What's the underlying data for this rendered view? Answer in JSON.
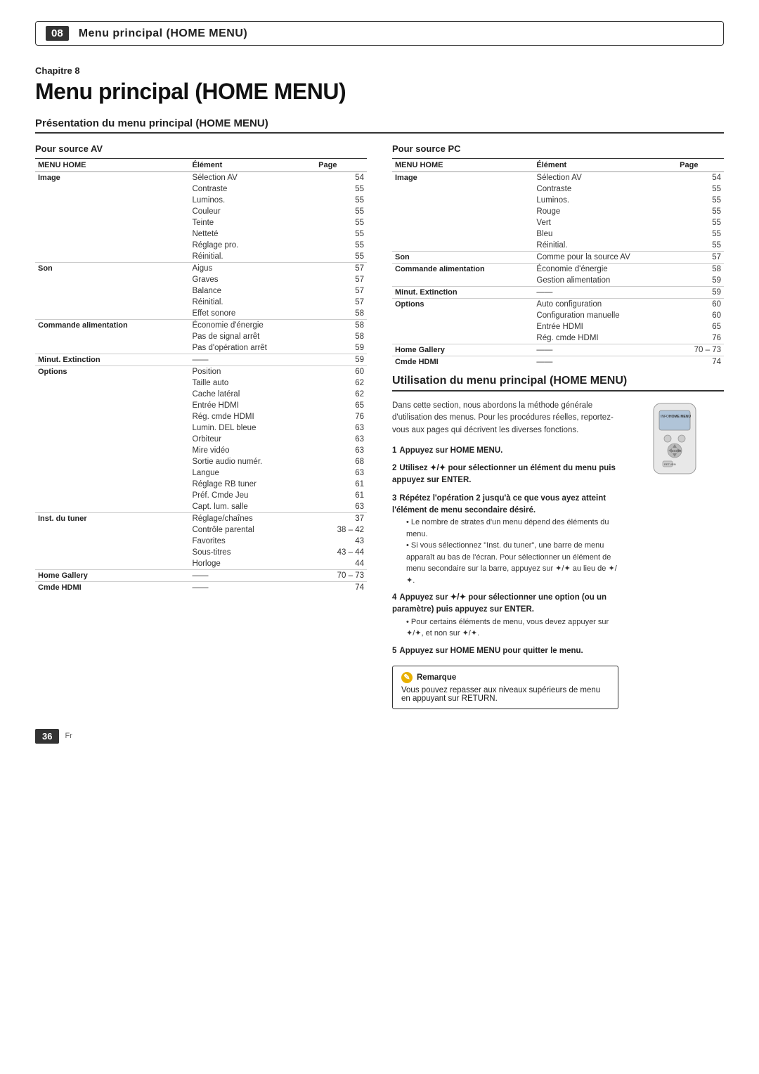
{
  "topbar": {
    "number": "08",
    "title": "Menu principal (HOME MENU)"
  },
  "chapter": {
    "label": "Chapitre 8",
    "title": "Menu principal (HOME MENU)"
  },
  "presentation": {
    "section_title": "Présentation du menu principal (HOME MENU)"
  },
  "av_source": {
    "label": "Pour source AV",
    "columns": [
      "MENU HOME",
      "Élément",
      "Page"
    ],
    "rows": [
      {
        "category": "Image",
        "item": "Sélection AV",
        "page": "54"
      },
      {
        "category": "",
        "item": "Contraste",
        "page": "55"
      },
      {
        "category": "",
        "item": "Luminos.",
        "page": "55"
      },
      {
        "category": "",
        "item": "Couleur",
        "page": "55"
      },
      {
        "category": "",
        "item": "Teinte",
        "page": "55"
      },
      {
        "category": "",
        "item": "Netteté",
        "page": "55"
      },
      {
        "category": "",
        "item": "Réglage pro.",
        "page": "55"
      },
      {
        "category": "",
        "item": "Réinitial.",
        "page": "55"
      },
      {
        "category": "Son",
        "item": "Aigus",
        "page": "57"
      },
      {
        "category": "",
        "item": "Graves",
        "page": "57"
      },
      {
        "category": "",
        "item": "Balance",
        "page": "57"
      },
      {
        "category": "",
        "item": "Réinitial.",
        "page": "57"
      },
      {
        "category": "",
        "item": "Effet sonore",
        "page": "58"
      },
      {
        "category": "Commande alimentation",
        "item": "Économie d'énergie",
        "page": "58"
      },
      {
        "category": "",
        "item": "Pas de signal arrêt",
        "page": "58"
      },
      {
        "category": "",
        "item": "Pas d'opération arrêt",
        "page": "59"
      },
      {
        "category": "Minut. Extinction",
        "item": "——",
        "page": "59"
      },
      {
        "category": "Options",
        "item": "Position",
        "page": "60"
      },
      {
        "category": "",
        "item": "Taille auto",
        "page": "62"
      },
      {
        "category": "",
        "item": "Cache latéral",
        "page": "62"
      },
      {
        "category": "",
        "item": "Entrée HDMI",
        "page": "65"
      },
      {
        "category": "",
        "item": "Rég. cmde HDMI",
        "page": "76"
      },
      {
        "category": "",
        "item": "Lumin. DEL bleue",
        "page": "63"
      },
      {
        "category": "",
        "item": "Orbiteur",
        "page": "63"
      },
      {
        "category": "",
        "item": "Mire vidéo",
        "page": "63"
      },
      {
        "category": "",
        "item": "Sortie audio numér.",
        "page": "68"
      },
      {
        "category": "",
        "item": "Langue",
        "page": "63"
      },
      {
        "category": "",
        "item": "Réglage RB tuner",
        "page": "61"
      },
      {
        "category": "",
        "item": "Préf. Cmde Jeu",
        "page": "61"
      },
      {
        "category": "",
        "item": "Capt. lum. salle",
        "page": "63"
      },
      {
        "category": "Inst. du tuner",
        "item": "Réglage/chaînes",
        "page": "37"
      },
      {
        "category": "",
        "item": "Contrôle parental",
        "page": "38 – 42"
      },
      {
        "category": "",
        "item": "Favorites",
        "page": "43"
      },
      {
        "category": "",
        "item": "Sous-titres",
        "page": "43 – 44"
      },
      {
        "category": "",
        "item": "Horloge",
        "page": "44"
      },
      {
        "category": "Home Gallery",
        "item": "——",
        "page": "70 – 73"
      },
      {
        "category": "Cmde HDMI",
        "item": "——",
        "page": "74"
      }
    ]
  },
  "pc_source": {
    "label": "Pour source PC",
    "columns": [
      "MENU HOME",
      "Élément",
      "Page"
    ],
    "rows": [
      {
        "category": "Image",
        "item": "Sélection AV",
        "page": "54"
      },
      {
        "category": "",
        "item": "Contraste",
        "page": "55"
      },
      {
        "category": "",
        "item": "Luminos.",
        "page": "55"
      },
      {
        "category": "",
        "item": "Rouge",
        "page": "55"
      },
      {
        "category": "",
        "item": "Vert",
        "page": "55"
      },
      {
        "category": "",
        "item": "Bleu",
        "page": "55"
      },
      {
        "category": "",
        "item": "Réinitial.",
        "page": "55"
      },
      {
        "category": "Son",
        "item": "Comme pour la source AV",
        "page": "57"
      },
      {
        "category": "Commande alimentation",
        "item": "Économie d'énergie",
        "page": "58"
      },
      {
        "category": "",
        "item": "Gestion alimentation",
        "page": "59"
      },
      {
        "category": "Minut. Extinction",
        "item": "——",
        "page": "59"
      },
      {
        "category": "Options",
        "item": "Auto configuration",
        "page": "60"
      },
      {
        "category": "",
        "item": "Configuration manuelle",
        "page": "60"
      },
      {
        "category": "",
        "item": "Entrée HDMI",
        "page": "65"
      },
      {
        "category": "",
        "item": "Rég. cmde HDMI",
        "page": "76"
      },
      {
        "category": "Home Gallery",
        "item": "——",
        "page": "70 – 73"
      },
      {
        "category": "Cmde HDMI",
        "item": "——",
        "page": "74"
      }
    ]
  },
  "utilisation": {
    "title": "Utilisation du menu principal (HOME MENU)",
    "intro": "Dans cette section, nous abordons la méthode générale d'utilisation des menus. Pour les procédures réelles, reportez-vous aux pages qui décrivent les diverses fonctions.",
    "steps": [
      {
        "num": "1",
        "text": "Appuyez sur HOME MENU.",
        "subs": []
      },
      {
        "num": "2",
        "text": "Utilisez ✦/✦ pour sélectionner un élément du menu puis appuyez sur ENTER.",
        "subs": []
      },
      {
        "num": "3",
        "text": "Répétez l'opération 2 jusqu'à ce que vous ayez atteint l'élément de menu secondaire désiré.",
        "subs": [
          "Le nombre de strates d'un menu dépend des éléments du menu.",
          "Si vous sélectionnez \"Inst. du tuner\", une barre de menu apparaît au bas de l'écran. Pour sélectionner un élément de menu secondaire sur la barre, appuyez sur ✦/✦ au lieu de ✦/✦."
        ]
      },
      {
        "num": "4",
        "text": "Appuyez sur ✦/✦ pour sélectionner une option (ou un paramètre) puis appuyez sur ENTER.",
        "subs": [
          "Pour certains éléments de menu, vous devez appuyer sur ✦/✦, et non sur ✦/✦."
        ]
      },
      {
        "num": "5",
        "text": "Appuyez sur HOME MENU pour quitter le menu.",
        "subs": []
      }
    ],
    "remarque": {
      "title": "Remarque",
      "text": "Vous pouvez repasser aux niveaux supérieurs de menu en appuyant sur RETURN."
    }
  },
  "footer": {
    "page_number": "36",
    "lang": "Fr"
  }
}
